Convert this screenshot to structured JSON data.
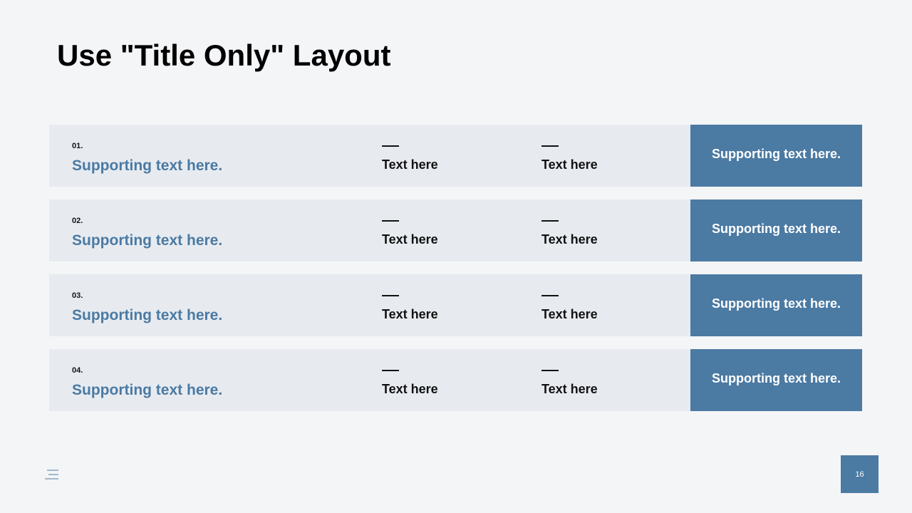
{
  "slide": {
    "title": "Use \"Title Only\" Layout",
    "page_number": "16",
    "accent_color": "#4b7aa3",
    "row_background": "#e7ebf0",
    "background": "#f4f5f7"
  },
  "rows": [
    {
      "number": "01.",
      "support_text": "Supporting text here.",
      "col1_text": "Text here",
      "col2_text": "Text here",
      "box_text": "Supporting text here."
    },
    {
      "number": "02.",
      "support_text": "Supporting text here.",
      "col1_text": "Text here",
      "col2_text": "Text here",
      "box_text": "Supporting text here."
    },
    {
      "number": "03.",
      "support_text": "Supporting text here.",
      "col1_text": "Text here",
      "col2_text": "Text here",
      "box_text": "Supporting text here."
    },
    {
      "number": "04.",
      "support_text": "Supporting text here.",
      "col1_text": "Text here",
      "col2_text": "Text here",
      "box_text": "Supporting text here."
    }
  ],
  "icons": {
    "footer_icon": "menu-icon"
  }
}
